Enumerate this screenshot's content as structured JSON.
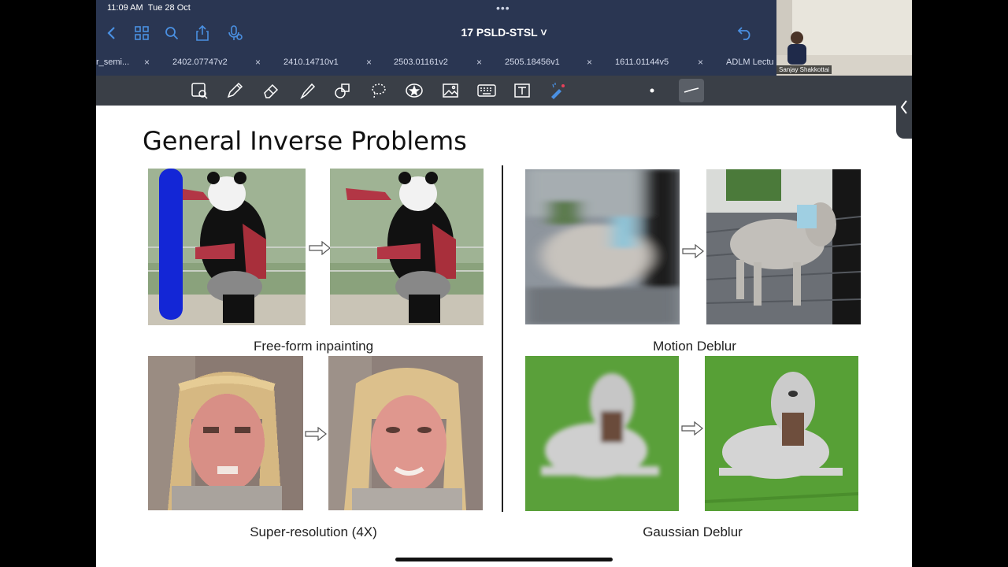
{
  "status": {
    "time": "11:09 AM",
    "date": "Tue 28 Oct"
  },
  "header": {
    "title": "17 PSLD-STSL ˅"
  },
  "tabs": [
    {
      "label": "r_semi..."
    },
    {
      "label": "2402.07747v2"
    },
    {
      "label": "2410.14710v1"
    },
    {
      "label": "2503.01161v2"
    },
    {
      "label": "2505.18456v1"
    },
    {
      "label": "1611.01144v5"
    },
    {
      "label": "ADLM Lectu"
    }
  ],
  "tab_close_glyph": "×",
  "webcam": {
    "name": "Sanjay Shakkottai"
  },
  "slide": {
    "title": "General Inverse Problems",
    "captions": {
      "inpainting": "Free-form inpainting",
      "motion": "Motion Deblur",
      "superres": "Super-resolution (4X)",
      "gaussian": "Gaussian Deblur"
    }
  },
  "colors": {
    "topbar": "#2a3652",
    "toolbar": "#3a3f47",
    "accent": "#4a90e2"
  }
}
